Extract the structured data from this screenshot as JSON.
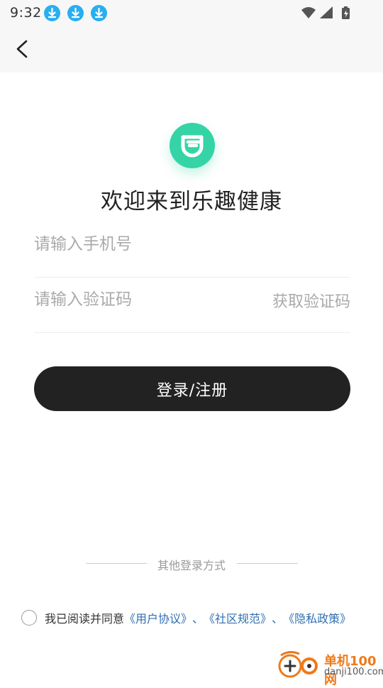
{
  "status_bar": {
    "time": "9:32",
    "notification_icons": [
      "download-icon",
      "download-icon",
      "download-icon"
    ],
    "right_icons": [
      "wifi-icon",
      "signal-icon",
      "battery-charging-icon"
    ]
  },
  "app_bar": {
    "back_icon": "chevron-left-icon"
  },
  "logo": {
    "icon": "lequ-logo-icon",
    "color": "#35d4a6"
  },
  "welcome_title": "欢迎来到乐趣健康",
  "phone_field": {
    "placeholder": "请输入手机号",
    "value": ""
  },
  "code_field": {
    "placeholder": "请输入验证码",
    "value": "",
    "get_code_label": "获取验证码"
  },
  "login_button": {
    "label": "登录/注册",
    "color": "#222222"
  },
  "other_login": {
    "label": "其他登录方式"
  },
  "agreement": {
    "prefix": "我已阅读并同意",
    "user_agreement": "《用户协议》",
    "sep1": "、",
    "community_rules": "《社区规范》",
    "sep2": "、",
    "privacy_policy": "《隐私政策》",
    "link_color": "#2f6fb0"
  },
  "watermark": {
    "cn": "单机100网",
    "en": "danji100.com"
  }
}
